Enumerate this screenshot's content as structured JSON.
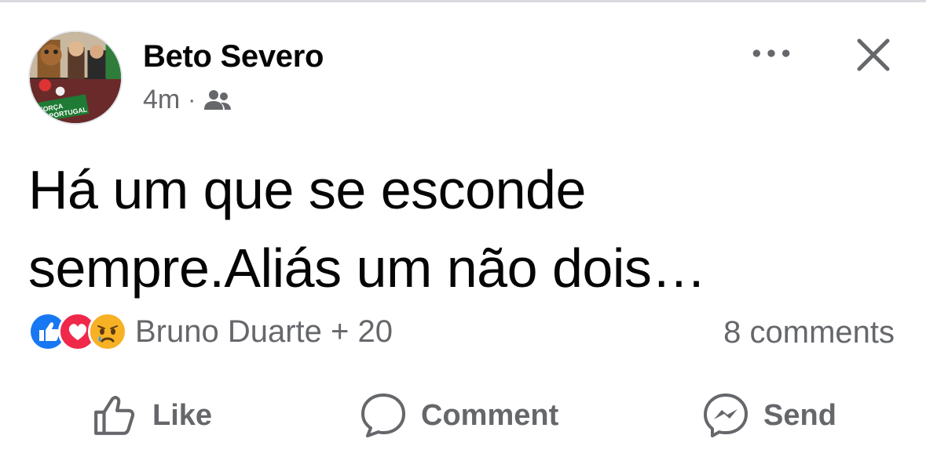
{
  "post": {
    "author": "Beto Severo",
    "time": "4m",
    "separator": "·",
    "audience_icon": "friends-icon",
    "more_icon": "more-dots-icon",
    "close_icon": "close-icon",
    "text": "Há um que se esconde sempre.Aliás um não dois…",
    "avatar_caption_line1": "FORÇA",
    "avatar_caption_line2": "PORTUGAL"
  },
  "reactions": {
    "icons": [
      "like-reaction-icon",
      "love-reaction-icon",
      "sad-reaction-icon"
    ],
    "summary": "Bruno Duarte + 20",
    "comments": "8 comments"
  },
  "actions": {
    "like": "Like",
    "comment": "Comment",
    "send": "Send"
  },
  "colors": {
    "text_primary": "#050505",
    "text_secondary": "#65676b",
    "like_blue": "#1877f2",
    "love_red": "#f02849",
    "sad_yellow": "#f7b125"
  }
}
